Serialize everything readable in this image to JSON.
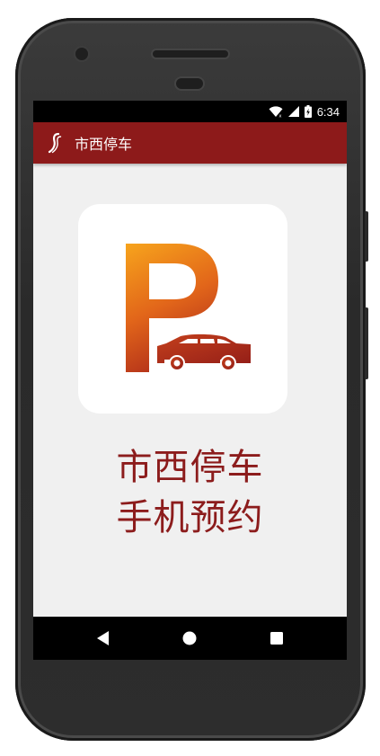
{
  "status_bar": {
    "time": "6:34",
    "icons": [
      "wifi-icon",
      "cellular-signal-icon",
      "battery-charging-icon"
    ]
  },
  "app_bar": {
    "title": "市西停车",
    "icon": "app-logo-icon",
    "background_color": "#8d1a1a"
  },
  "splash": {
    "logo": "parking-car-logo",
    "headline_line1": "市西停车",
    "headline_line2": "手机预约",
    "headline_color": "#8c1c1c"
  },
  "nav_bar": {
    "buttons": [
      "back-icon",
      "home-icon",
      "recents-icon"
    ]
  }
}
